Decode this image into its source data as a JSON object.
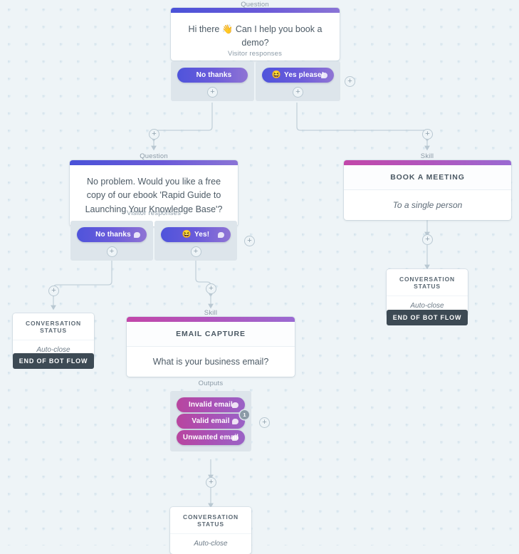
{
  "canvas": {
    "background": "#eef4f7",
    "dot_color": "#dfebf2"
  },
  "colors": {
    "question_bar_from": "#4a52d8",
    "question_bar_to": "#8a74d6",
    "skill_bar_from": "#c247a9",
    "skill_bar_to": "#9a6ad2",
    "pill_blue": "#5a57da",
    "pill_magenta": "#b8459f",
    "end_flow_bg": "#3d4a54"
  },
  "captions": {
    "question": "Question",
    "skill": "Skill",
    "visitor_responses": "Visitor responses",
    "outputs": "Outputs"
  },
  "nodes": {
    "question1": {
      "caption": "Question",
      "text": "Hi there 👋 Can I help you book a demo?"
    },
    "responses1": {
      "caption": "Visitor responses",
      "buttons": [
        {
          "label": "No thanks",
          "emoji": "",
          "has_chat_icon": false,
          "add_label": "+"
        },
        {
          "label": "Yes please!",
          "emoji": "😆",
          "has_chat_icon": true,
          "add_label": "+"
        }
      ],
      "add_response_label": "+"
    },
    "question2": {
      "caption": "Question",
      "text": "No problem. Would you like a free copy of our ebook 'Rapid Guide to Launching Your Knowledge Base'?"
    },
    "responses2": {
      "caption": "Visitor responses",
      "buttons": [
        {
          "label": "No thanks",
          "emoji": "",
          "has_chat_icon": true,
          "add_label": "+"
        },
        {
          "label": "Yes!",
          "emoji": "😆",
          "has_chat_icon": true,
          "add_label": "+"
        }
      ],
      "add_response_label": "+"
    },
    "skill_meeting": {
      "caption": "Skill",
      "title": "BOOK A MEETING",
      "subtitle": "To a single person"
    },
    "status_meeting": {
      "title": "CONVERSATION STATUS",
      "value": "Auto-close",
      "end_label": "END OF BOT FLOW"
    },
    "status_left": {
      "title": "CONVERSATION STATUS",
      "value": "Auto-close",
      "end_label": "END OF BOT FLOW"
    },
    "skill_email": {
      "caption": "Skill",
      "title": "EMAIL CAPTURE",
      "subtitle": "What is your business email?"
    },
    "outputs": {
      "caption": "Outputs",
      "pills": [
        {
          "label": "Invalid email",
          "has_chat_icon": true,
          "badge": ""
        },
        {
          "label": "Valid email",
          "has_chat_icon": true,
          "badge": "1"
        },
        {
          "label": "Unwanted email",
          "has_chat_icon": true,
          "badge": ""
        }
      ],
      "add_output_label": "+"
    },
    "status_bottom": {
      "title": "CONVERSATION STATUS",
      "value": "Auto-close"
    }
  },
  "add_buttons": {
    "label": "+"
  }
}
